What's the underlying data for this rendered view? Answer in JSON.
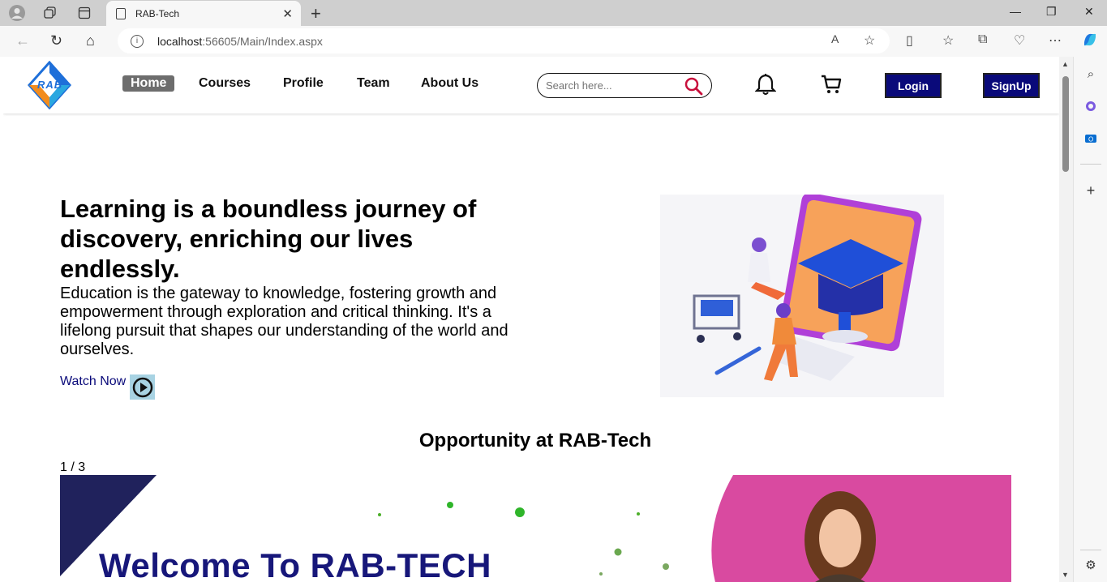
{
  "browser": {
    "tab_title": "RAB-Tech",
    "url_host": "localhost",
    "url_path": ":56605/Main/Index.aspx"
  },
  "header": {
    "logo_text": "RAB",
    "nav": [
      "Home",
      "Courses",
      "Profile",
      "Team",
      "About Us"
    ],
    "search_placeholder": "Search here...",
    "login_label": "Login",
    "signup_label": "SignUp"
  },
  "hero": {
    "title": "Learning is a boundless journey of discovery, enriching our lives endlessly.",
    "text": "Education is the gateway to knowledge, fostering growth and empowerment through exploration and critical thinking. It's a lifelong pursuit that shapes our understanding of the world and ourselves.",
    "watch_label": "Watch Now"
  },
  "opportunity": {
    "title": "Opportunity at RAB-Tech",
    "slide_counter": "1 / 3",
    "slide_heading": "Welcome To RAB-TECH"
  },
  "colors": {
    "brand_navy": "#0a0a7a",
    "slide_pink": "#d94aa0",
    "slide_triangle": "#20225c"
  }
}
